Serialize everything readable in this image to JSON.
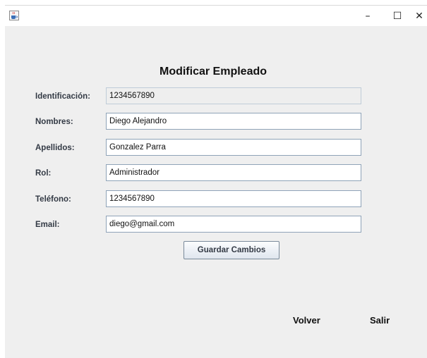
{
  "window": {
    "icon": "java-cup-icon",
    "controls": {
      "minimize": "–",
      "maximize": "☐",
      "close": "✕"
    }
  },
  "form": {
    "title": "Modificar Empleado",
    "fields": [
      {
        "label": "Identificación:",
        "value": "1234567890"
      },
      {
        "label": "Nombres:",
        "value": "Diego Alejandro"
      },
      {
        "label": "Apellidos:",
        "value": "Gonzalez Parra"
      },
      {
        "label": "Rol:",
        "value": "Administrador"
      },
      {
        "label": "Teléfono:",
        "value": "1234567890"
      },
      {
        "label": "Email:",
        "value": "diego@gmail.com"
      }
    ],
    "save_label": "Guardar Cambios"
  },
  "footer": {
    "back_label": "Volver",
    "exit_label": "Salir"
  }
}
